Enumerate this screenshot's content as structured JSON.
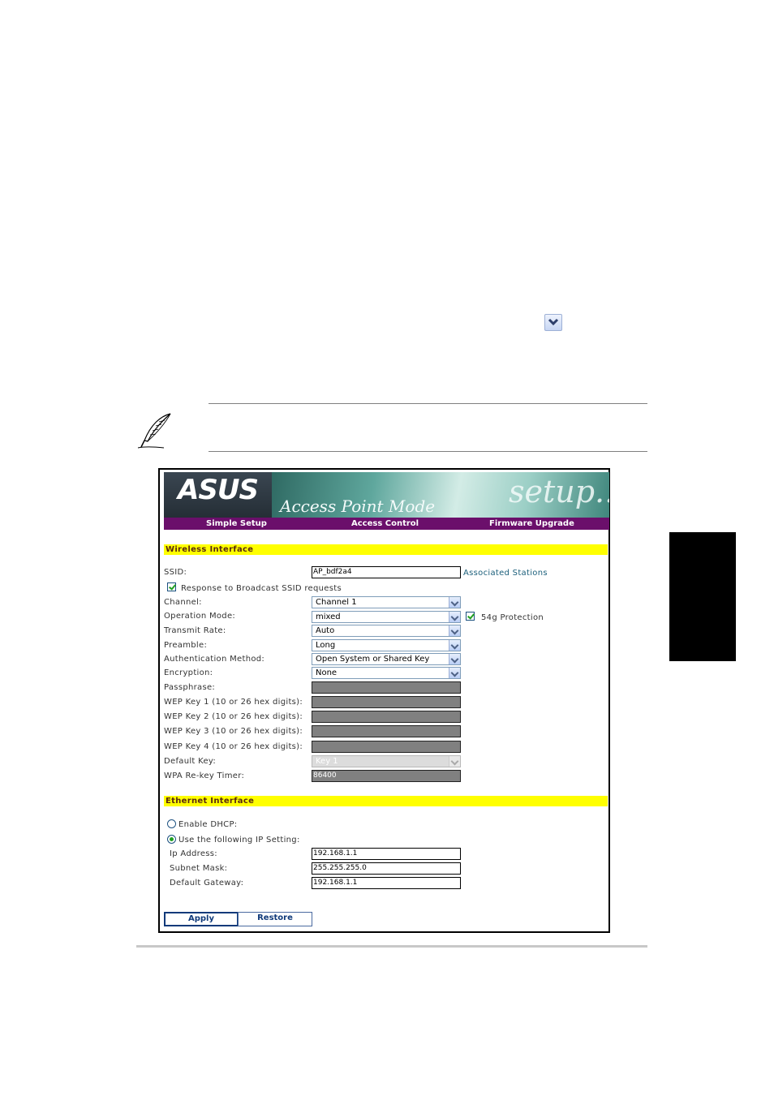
{
  "banner": {
    "logo": "ASUS",
    "mode": "Access Point Mode",
    "tagline": "setup..."
  },
  "menu": {
    "items": [
      "Simple Setup",
      "Access Control",
      "Firmware Upgrade"
    ]
  },
  "wireless": {
    "section_title": "Wireless Interface",
    "ssid_label": "SSID:",
    "ssid_value": "AP_bdf2a4",
    "associated_stations": "Associated Stations",
    "broadcast_label": "Response to Broadcast SSID requests",
    "channel_label": "Channel:",
    "channel_value": "Channel 1",
    "operation_mode_label": "Operation Mode:",
    "operation_mode_value": "mixed",
    "protection_label": "54g Protection",
    "transmit_rate_label": "Transmit Rate:",
    "transmit_rate_value": "Auto",
    "preamble_label": "Preamble:",
    "preamble_value": "Long",
    "auth_label": "Authentication Method:",
    "auth_value": "Open System or Shared Key",
    "encryption_label": "Encryption:",
    "encryption_value": "None",
    "passphrase_label": "Passphrase:",
    "wep1_label": "WEP Key 1 (10 or 26 hex digits):",
    "wep2_label": "WEP Key 2 (10 or 26 hex digits):",
    "wep3_label": "WEP Key 3 (10 or 26 hex digits):",
    "wep4_label": "WEP Key 4 (10 or 26 hex digits):",
    "default_key_label": "Default Key:",
    "default_key_value": "Key 1",
    "rekey_label": "WPA Re-key Timer:",
    "rekey_value": "86400"
  },
  "ethernet": {
    "section_title": "Ethernet Interface",
    "dhcp_label": "Enable DHCP:",
    "static_label": "Use the following IP Setting:",
    "ip_label": "Ip Address:",
    "ip_value": "192.168.1.1",
    "mask_label": "Subnet Mask:",
    "mask_value": "255.255.255.0",
    "gateway_label": "Default Gateway:",
    "gateway_value": "192.168.1.1"
  },
  "buttons": {
    "apply": "Apply",
    "restore": "Restore"
  },
  "icons": {
    "dropdown": "chevron-down-icon",
    "note": "feather-pen-icon"
  },
  "colors": {
    "menubar": "#6b0f6b",
    "section_bar": "#ffff00",
    "side_tab": "#000000"
  }
}
